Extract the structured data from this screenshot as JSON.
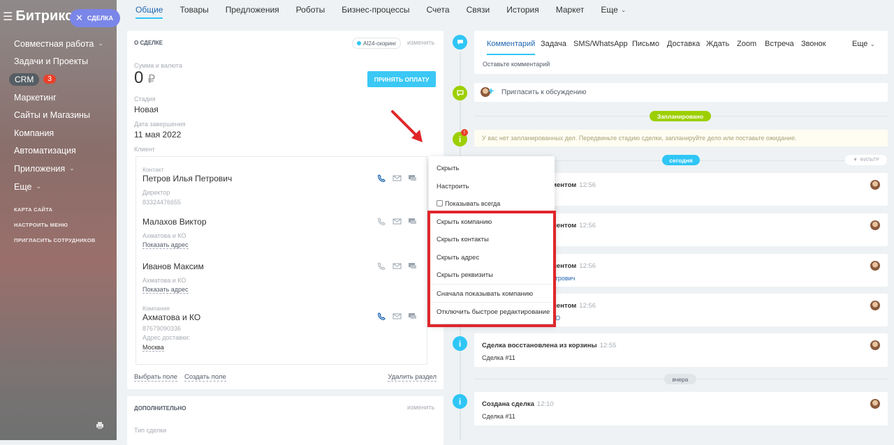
{
  "sidebar": {
    "logo": "Битрикс",
    "deal_chip": "СДЕЛКА",
    "items": [
      {
        "label": "Совместная работа",
        "chev": true
      },
      {
        "label": "Задачи и Проекты"
      },
      {
        "label": "CRM",
        "badge": "3"
      },
      {
        "label": "Маркетинг"
      },
      {
        "label": "Сайты и Магазины"
      },
      {
        "label": "Компания"
      },
      {
        "label": "Автоматизация"
      },
      {
        "label": "Приложения",
        "chev": true
      },
      {
        "label": "Еще",
        "chev": true
      }
    ],
    "small": [
      "КАРТА САЙТА",
      "НАСТРОИТЬ МЕНЮ",
      "ПРИГЛАСИТЬ СОТРУДНИКОВ"
    ]
  },
  "topnav": [
    "Общие",
    "Товары",
    "Предложения",
    "Роботы",
    "Бизнес-процессы",
    "Счета",
    "Связи",
    "История",
    "Маркет",
    "Еще"
  ],
  "deal": {
    "title": "О СДЕЛКЕ",
    "ai_chip": "AI24-скоринг",
    "change": "изменить",
    "sum_label": "Сумма и валюта",
    "amount": "0",
    "currency": "₽",
    "pay_button": "ПРИНЯТЬ ОПЛАТУ",
    "stage_label": "Стадия",
    "stage": "Новая",
    "end_label": "Дата завершения",
    "end_date": "11 мая 2022",
    "client_label": "Клиент",
    "contact_label": "Контакт",
    "contacts": [
      {
        "name": "Петров Илья Петрович",
        "line1": "Директор",
        "line2": "83324476655"
      },
      {
        "name": "Малахов Виктор",
        "line1": "Ахматова и КО",
        "line2": "Показать адрес"
      },
      {
        "name": "Иванов Максим",
        "line1": "Ахматова и КО",
        "line2": "Показать адрес"
      }
    ],
    "company_label": "Компания",
    "company": {
      "name": "Ахматова и КО",
      "phone": "87679090336",
      "addr_label": "Адрес доставки:",
      "addr": "Москва"
    },
    "select_field": "Выбрать поле",
    "create_field": "Создать поле",
    "delete_section": "Удалить раздел"
  },
  "extra": {
    "title": "ДОПОЛНИТЕЛЬНО",
    "change": "изменить",
    "type_label": "Тип сделки"
  },
  "dropdown": {
    "hide": "Скрыть",
    "configure": "Настроить",
    "always_show": "Показывать всегда",
    "hide_company": "Скрыть компанию",
    "hide_contacts": "Скрыть контакты",
    "hide_address": "Скрыть адрес",
    "hide_requisites": "Скрыть реквизиты",
    "company_first": "Сначала показывать компанию",
    "disable_quick_edit": "Отключить быстрое редактирование"
  },
  "comment": {
    "tabs": [
      "Комментарий",
      "Задача",
      "SMS/WhatsApp",
      "Письмо",
      "Доставка",
      "Ждать",
      "Zoom",
      "Встреча",
      "Звонок"
    ],
    "more": "Еще",
    "placeholder": "Оставьте комментарий"
  },
  "invite": "Пригласить к обсуждению",
  "planned": "Запланировано",
  "plan_text": "У вас нет запланированных дел. Передвиньте стадию сделки, запланируйте дело или поставьте ожидание.",
  "today": "сегодня",
  "filter": "ФИЛЬТР",
  "events": [
    {
      "title": "ментом",
      "time": "12:56",
      "link": ""
    },
    {
      "title": "ментом",
      "time": "12:56",
      "link": "о"
    },
    {
      "title": "ментом",
      "time": "12:56",
      "link": "етрович"
    },
    {
      "title": "ментом",
      "time": "12:56",
      "link": "КО"
    }
  ],
  "restored": {
    "title": "Сделка восстановлена из корзины",
    "time": "12:55",
    "sub": "Сделка #11"
  },
  "yesterday": "вчера",
  "created": {
    "title": "Создана сделка",
    "time": "12:10",
    "sub": "Сделка #11"
  },
  "colors": {
    "accent": "#2fc6f6",
    "red_outline": "#e0262b",
    "green": "#9dcf00"
  }
}
